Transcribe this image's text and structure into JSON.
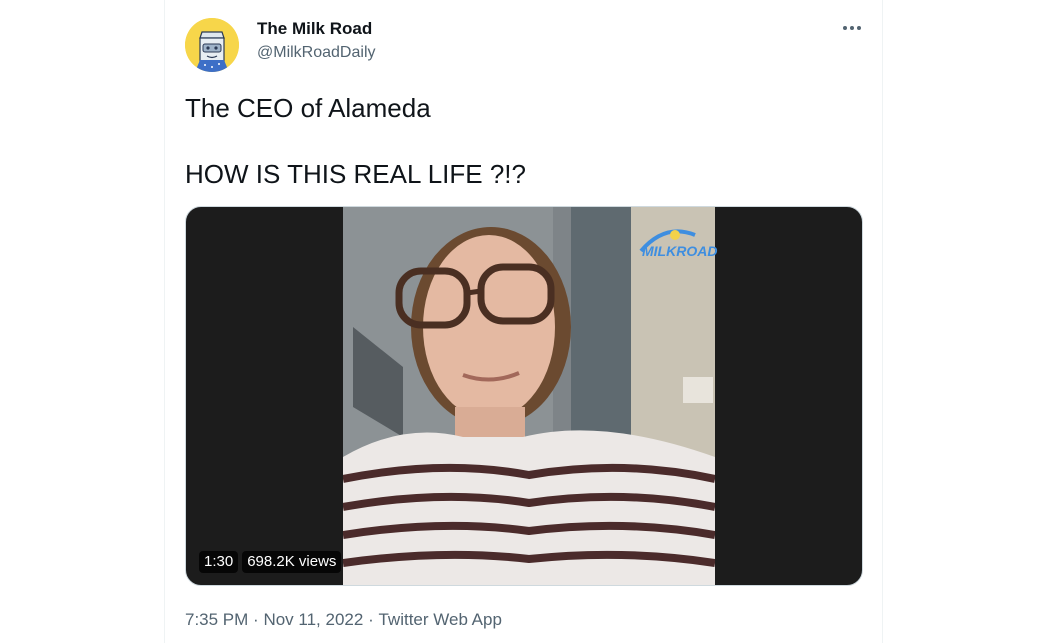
{
  "tweet": {
    "display_name": "The Milk Road",
    "handle": "@MilkRoadDaily",
    "text": "The CEO of Alameda\n\nHOW IS THIS REAL LIFE ?!?",
    "video": {
      "duration": "1:30",
      "views": "698.2K views",
      "watermark": "MILKROAD"
    },
    "meta": {
      "time": "7:35 PM",
      "separator": "·",
      "date": "Nov 11, 2022",
      "source": "Twitter Web App"
    }
  },
  "colors": {
    "text_primary": "#0f1419",
    "text_secondary": "#536471",
    "avatar_bg": "#f7d64a"
  },
  "icons": {
    "more": "more-horizontal-icon",
    "avatar": "milk-carton-avatar"
  }
}
